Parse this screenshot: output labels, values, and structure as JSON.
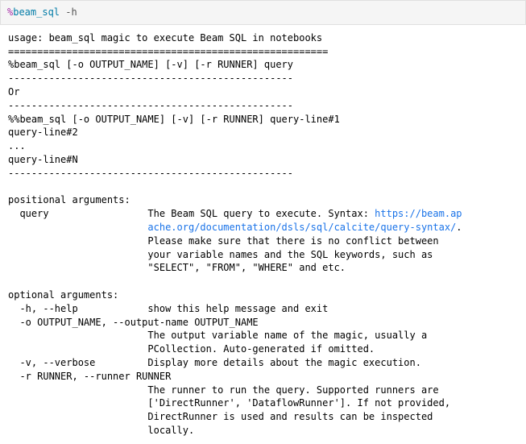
{
  "cell": {
    "percent": "%",
    "cmd": "beam_sql",
    "space_flag": " -h"
  },
  "out": {
    "usage_line": "usage: beam_sql magic to execute Beam SQL in notebooks",
    "rule": "=======================================================",
    "single_line": "%beam_sql [-o OUTPUT_NAME] [-v] [-r RUNNER] query",
    "dash_rule": "-------------------------------------------------",
    "or_line": "Or",
    "dash_rule2": "-------------------------------------------------",
    "cell_line1": "%%beam_sql [-o OUTPUT_NAME] [-v] [-r RUNNER] query-line#1",
    "cell_line2": "query-line#2",
    "cell_line3": "...",
    "cell_line4": "query-line#N",
    "dash_rule3": "-------------------------------------------------",
    "blank1": "",
    "positional_header": "positional arguments:",
    "query_line1": "  query                 The Beam SQL query to execute. Syntax: ",
    "query_link_txt": "https://beam.ap",
    "query_link_href": "https://beam.apache.org/documentation/dsls/sql/calcite/query-syntax/",
    "query_line2": "                        ache.org/documentation/dsls/sql/calcite/query-syntax/",
    "query_line2b": ".",
    "query_line3": "                        Please make sure that there is no conflict between",
    "query_line4": "                        your variable names and the SQL keywords, such as",
    "query_line5": "                        \"SELECT\", \"FROM\", \"WHERE\" and etc.",
    "blank2": "",
    "optional_header": "optional arguments:",
    "help_line": "  -h, --help            show this help message and exit",
    "out_line1": "  -o OUTPUT_NAME, --output-name OUTPUT_NAME",
    "out_line2": "                        The output variable name of the magic, usually a",
    "out_line3": "                        PCollection. Auto-generated if omitted.",
    "verbose_line": "  -v, --verbose         Display more details about the magic execution.",
    "run_line1": "  -r RUNNER, --runner RUNNER",
    "run_line2": "                        The runner to run the query. Supported runners are",
    "run_line3": "                        ['DirectRunner', 'DataflowRunner']. If not provided,",
    "run_line4": "                        DirectRunner is used and results can be inspected",
    "run_line5": "                        locally."
  }
}
